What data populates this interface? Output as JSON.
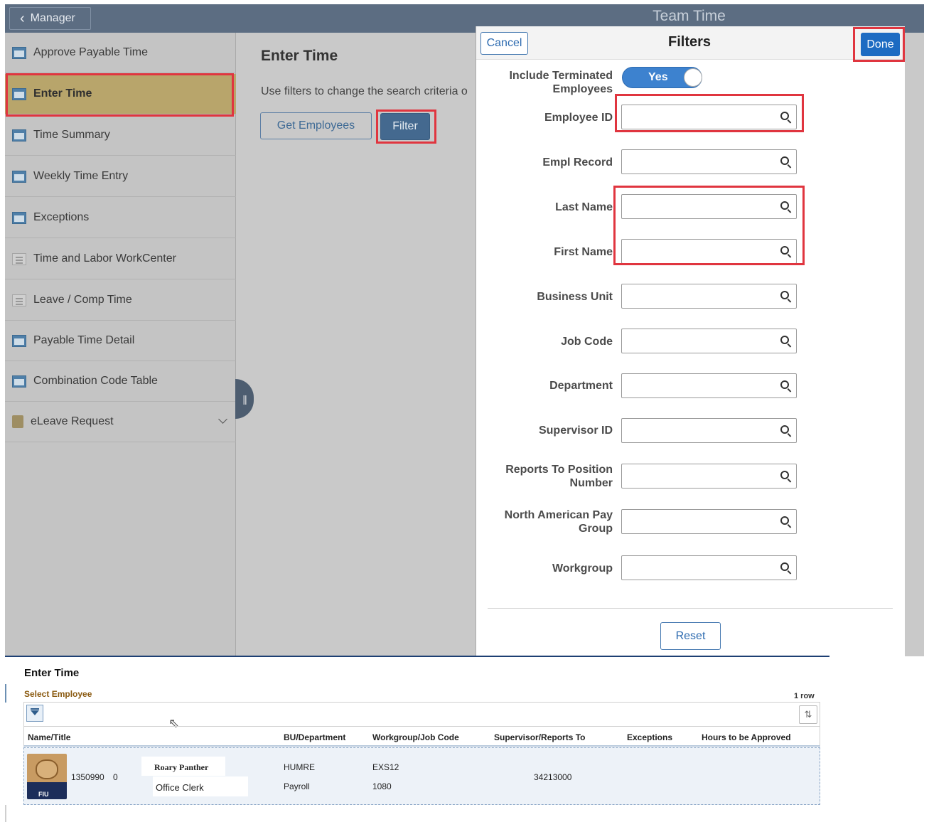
{
  "header": {
    "back_label": "Manager",
    "app_title": "Team Time"
  },
  "sidebar": {
    "items": [
      {
        "label": "Approve Payable Time",
        "icon": "window-icon"
      },
      {
        "label": "Enter Time",
        "icon": "window-icon",
        "active": true
      },
      {
        "label": "Time Summary",
        "icon": "window-icon"
      },
      {
        "label": "Weekly Time Entry",
        "icon": "window-icon"
      },
      {
        "label": "Exceptions",
        "icon": "window-icon"
      },
      {
        "label": "Time and Labor WorkCenter",
        "icon": "document-icon"
      },
      {
        "label": "Leave / Comp Time",
        "icon": "document-icon"
      },
      {
        "label": "Payable Time Detail",
        "icon": "window-icon"
      },
      {
        "label": "Combination Code Table",
        "icon": "window-icon"
      },
      {
        "label": "eLeave Request",
        "icon": "folder-icon"
      }
    ]
  },
  "main": {
    "title": "Enter Time",
    "instructions": "Use filters to change the search criteria o",
    "get_employees_label": "Get Employees",
    "filter_label": "Filter"
  },
  "filters": {
    "title": "Filters",
    "cancel_label": "Cancel",
    "done_label": "Done",
    "include_terminated_label": "Include Terminated Employees",
    "include_terminated_value": "Yes",
    "fields": [
      {
        "label": "Employee ID",
        "value": ""
      },
      {
        "label": "Empl Record",
        "value": ""
      },
      {
        "label": "Last Name",
        "value": ""
      },
      {
        "label": "First Name",
        "value": ""
      },
      {
        "label": "Business Unit",
        "value": ""
      },
      {
        "label": "Job Code",
        "value": ""
      },
      {
        "label": "Department",
        "value": ""
      },
      {
        "label": "Supervisor ID",
        "value": ""
      },
      {
        "label": "Reports To Position Number",
        "value": ""
      },
      {
        "label": "North American Pay Group",
        "value": ""
      },
      {
        "label": "Workgroup",
        "value": ""
      }
    ],
    "reset_label": "Reset"
  },
  "results": {
    "title": "Enter Time",
    "subtitle": "Select Employee",
    "row_count": "1 row",
    "columns": [
      "Name/Title",
      "BU/Department",
      "Workgroup/Job Code",
      "Supervisor/Reports To",
      "Exceptions",
      "Hours to be Approved"
    ],
    "rows": [
      {
        "empl_id": "1350990",
        "empl_rcd": "0",
        "name": "Roary Panther",
        "title": "Office Clerk",
        "bu": "HUMRE",
        "department": "Payroll",
        "workgroup": "EXS12",
        "job_code": "1080",
        "reports_to": "34213000",
        "exceptions": "",
        "hours": ""
      }
    ]
  },
  "colors": {
    "header": "#5c6d82",
    "active_nav": "#b8a56b",
    "highlight": "#e0353f",
    "primary": "#1d6bc2",
    "subtitle": "#8a5a10"
  }
}
